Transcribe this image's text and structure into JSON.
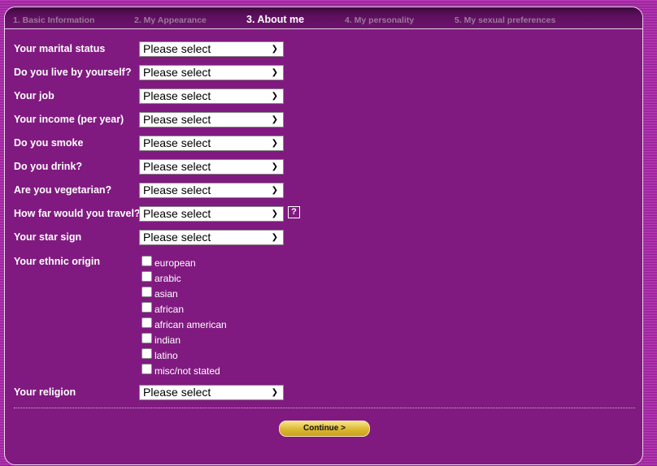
{
  "steps": [
    {
      "label": "1. Basic Information",
      "active": false
    },
    {
      "label": "2. My Appearance",
      "active": false
    },
    {
      "label": "3. About me",
      "active": true
    },
    {
      "label": "4. My personality",
      "active": false
    },
    {
      "label": "5. My sexual preferences",
      "active": false
    }
  ],
  "fields": [
    {
      "label": "Your marital status",
      "value": "Please select"
    },
    {
      "label": "Do you live by yourself?",
      "value": "Please select"
    },
    {
      "label": "Your job",
      "value": "Please select"
    },
    {
      "label": "Your income (per year)",
      "value": "Please select"
    },
    {
      "label": "Do you smoke",
      "value": "Please select"
    },
    {
      "label": "Do you drink?",
      "value": "Please select"
    },
    {
      "label": "Are you vegetarian?",
      "value": "Please select"
    },
    {
      "label": "How far would you travel?",
      "value": "Please select",
      "help": "?"
    },
    {
      "label": "Your star sign",
      "value": "Please select"
    }
  ],
  "ethnic": {
    "label": "Your ethnic origin",
    "options": [
      {
        "label": "european",
        "checked": false
      },
      {
        "label": "arabic",
        "checked": false
      },
      {
        "label": "asian",
        "checked": false
      },
      {
        "label": "african",
        "checked": false
      },
      {
        "label": "african american",
        "checked": false
      },
      {
        "label": "indian",
        "checked": false
      },
      {
        "label": "latino",
        "checked": false
      },
      {
        "label": "misc/not stated",
        "checked": false
      }
    ]
  },
  "religion": {
    "label": "Your religion",
    "value": "Please select"
  },
  "continue_label": "Continue >",
  "colors": {
    "panel": "#801a80",
    "header": "#5e0f5e",
    "button": "#dcb830"
  }
}
